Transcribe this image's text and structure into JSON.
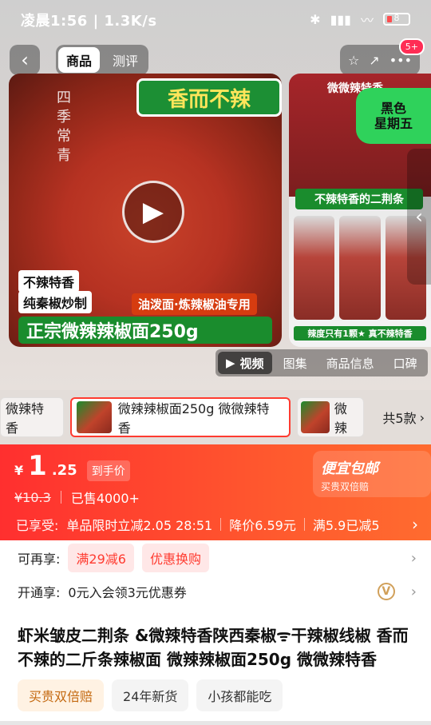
{
  "status": {
    "time": "凌晨1:56",
    "speed": "1.3K/s",
    "battery": "8"
  },
  "top": {
    "tabs": [
      "商品",
      "测评"
    ],
    "badge": "5+",
    "icons": [
      "back-icon",
      "star-icon",
      "share-icon",
      "more-icon"
    ]
  },
  "gallery": {
    "main": {
      "brand_vertical": "四季常青",
      "tag_top": "香而不辣",
      "tag_left_1": "不辣特香",
      "tag_left_2": "纯秦椒炒制",
      "tag_oil": "油泼面·炼辣椒油专用",
      "tag_bottom": "正宗微辣辣椒面250g"
    },
    "side": {
      "line1": "微微辣特香",
      "line2": "不辣特香的二荆条",
      "foot": "辣度只有1颗★ 真不辣特香"
    },
    "promo_bubble": "黑色\n星期五",
    "media_tabs": [
      "视频",
      "图集",
      "商品信息",
      "口碑"
    ]
  },
  "sku": {
    "first": "微辣特香",
    "selected": "微辣辣椒面250g 微微辣特香",
    "other": "微辣",
    "count": "共5款"
  },
  "price": {
    "yen": "¥",
    "integer": "1",
    "decimal": ".25",
    "tag": "到手价",
    "original": "¥10.3",
    "sold": "已售4000+",
    "promo_title": "便宜包邮",
    "promo_sub": "买贵双倍赔",
    "enjoy_label": "已享受:",
    "enjoy_1": "单品限时立减2.05 28:51",
    "enjoy_2": "降价6.59元",
    "enjoy_3": "满5.9已减5"
  },
  "more": {
    "label": "可再享:",
    "pill_1": "满29减6",
    "pill_2": "优惠换购"
  },
  "membership": {
    "label": "开通享:",
    "text": "0元入会领3元优惠券"
  },
  "title": "虾米皱皮二荆条 &微辣特香陕西秦椒ᯤ干辣椒线椒 香而不辣的二斤条辣椒面 微辣辣椒面250g 微微辣特香",
  "tags": [
    "买贵双倍赔",
    "24年新货",
    "小孩都能吃"
  ]
}
